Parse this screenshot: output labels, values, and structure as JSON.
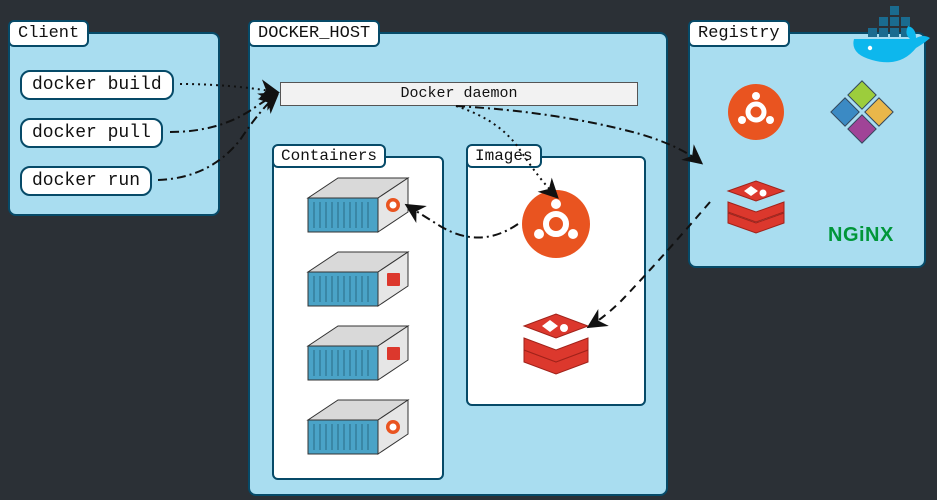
{
  "client": {
    "title": "Client",
    "commands": [
      "docker build",
      "docker pull",
      "docker run"
    ]
  },
  "host": {
    "title": "DOCKER_HOST",
    "daemon_label": "Docker daemon",
    "containers_title": "Containers",
    "images_title": "Images",
    "images": [
      "ubuntu",
      "redis"
    ],
    "containers": [
      {
        "image": "ubuntu"
      },
      {
        "image": "redis"
      },
      {
        "image": "redis"
      },
      {
        "image": "ubuntu"
      }
    ]
  },
  "registry": {
    "title": "Registry",
    "images": [
      "ubuntu",
      "centos",
      "redis",
      "nginx"
    ],
    "nginx_label": "NGiNX"
  },
  "arrows": [
    {
      "from": "docker build",
      "to": "Docker daemon",
      "style": "dotted"
    },
    {
      "from": "docker pull",
      "to": "Docker daemon",
      "style": "dash-dot"
    },
    {
      "from": "docker run",
      "to": "Docker daemon",
      "style": "dash-dot"
    },
    {
      "from": "Docker daemon",
      "to": "Images/ubuntu",
      "style": "dotted"
    },
    {
      "from": "Docker daemon",
      "to": "Registry",
      "style": "dash-dot"
    },
    {
      "from": "Registry",
      "to": "Images/redis",
      "style": "dashed"
    },
    {
      "from": "Images/ubuntu",
      "to": "Containers[0]",
      "style": "dash-dot"
    }
  ],
  "colors": {
    "panel_fill": "#a9ddf0",
    "panel_border": "#064a68",
    "ubuntu": "#e95420",
    "redis": "#dc382d",
    "nginx": "#009639",
    "docker_whale": "#0db7ed",
    "docker_boxes": "#1a6b8f"
  }
}
